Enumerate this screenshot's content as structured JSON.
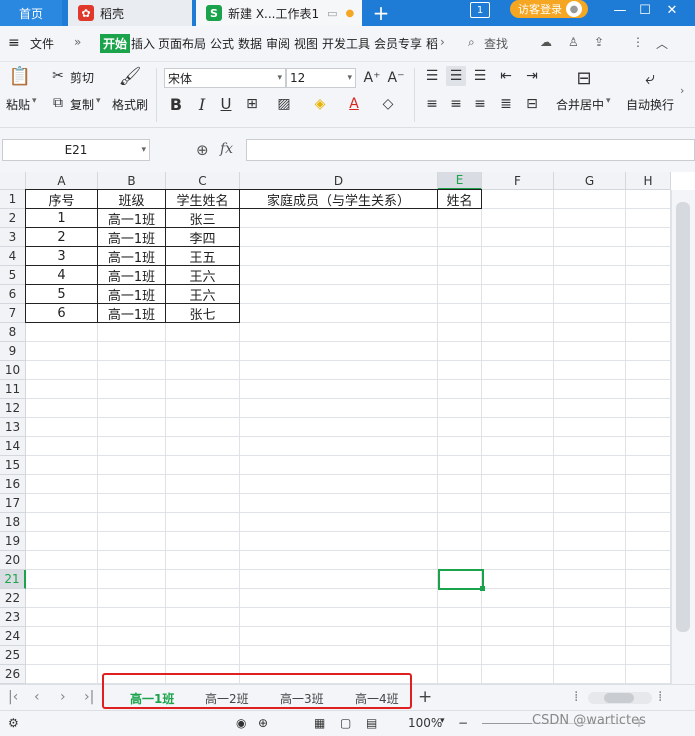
{
  "tabbar": {
    "home": "首页",
    "doc_tab": "稻壳",
    "active_tab": "新建 X...工作表1",
    "login": "访客登录"
  },
  "menubar": {
    "file": "文件",
    "tabs": [
      "开始",
      "插入",
      "页面布局",
      "公式",
      "数据",
      "审阅",
      "视图",
      "开发工具",
      "会员专享",
      "稻"
    ],
    "search": "查找"
  },
  "ribbon": {
    "paste": "粘贴",
    "cut": "剪切",
    "copy": "复制",
    "format_painter": "格式刷",
    "font_name": "宋体",
    "font_size": "12",
    "merge": "合并居中",
    "wrap": "自动换行"
  },
  "formula": {
    "namebox": "E21",
    "fx": "fx"
  },
  "columns": [
    "A",
    "B",
    "C",
    "D",
    "E",
    "F",
    "G",
    "H"
  ],
  "rows": [
    "1",
    "2",
    "3",
    "4",
    "5",
    "6",
    "7",
    "8",
    "9",
    "10",
    "11",
    "12",
    "13",
    "14",
    "15",
    "16",
    "17",
    "18",
    "19",
    "20",
    "21",
    "22",
    "23",
    "24",
    "25",
    "26"
  ],
  "table": {
    "headers": [
      "序号",
      "班级",
      "学生姓名",
      "家庭成员（与学生关系）",
      "姓名"
    ],
    "rows": [
      [
        "1",
        "高一1班",
        "张三"
      ],
      [
        "2",
        "高一1班",
        "李四"
      ],
      [
        "3",
        "高一1班",
        "王五"
      ],
      [
        "4",
        "高一1班",
        "王六"
      ],
      [
        "5",
        "高一1班",
        "王六"
      ],
      [
        "6",
        "高一1班",
        "张七"
      ]
    ]
  },
  "sheets": [
    "高一1班",
    "高一2班",
    "高一3班",
    "高一4班"
  ],
  "status": {
    "zoom": "100%",
    "watermark": "CSDN @wartictes"
  }
}
